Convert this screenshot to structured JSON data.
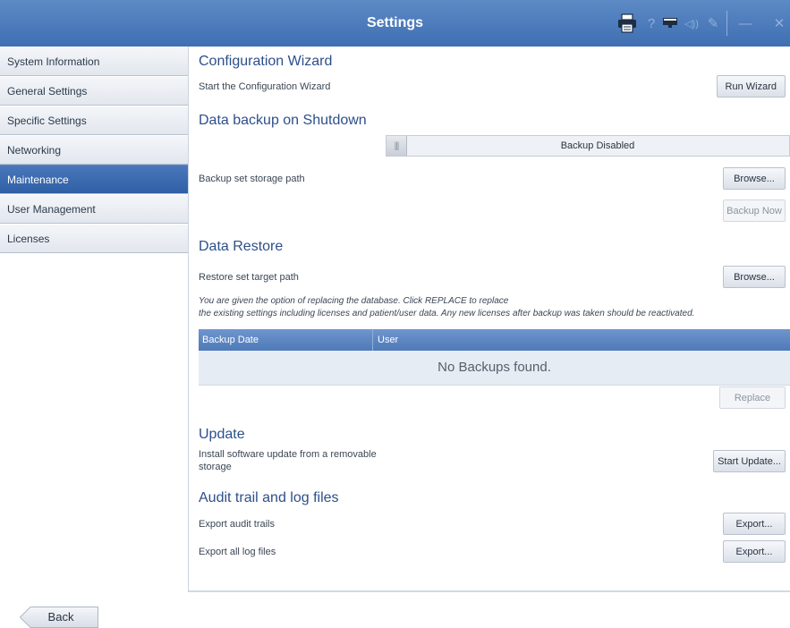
{
  "app": {
    "title": "Settings"
  },
  "toolbar": {
    "icons": [
      "printer-icon",
      "help-icon",
      "display-icon",
      "volume-icon",
      "tools-icon",
      "minimize-icon",
      "close-icon"
    ],
    "help_glyph": "?",
    "volume_glyph": "◁))",
    "tools_glyph": "✎",
    "minimize_glyph": "—",
    "close_glyph": "✕"
  },
  "sidebar": {
    "items": [
      {
        "label": "System Information"
      },
      {
        "label": "General Settings"
      },
      {
        "label": "Specific Settings"
      },
      {
        "label": "Networking"
      },
      {
        "label": "Maintenance",
        "active": true
      },
      {
        "label": "User Management"
      },
      {
        "label": "Licenses"
      }
    ]
  },
  "config_wizard": {
    "title": "Configuration Wizard",
    "description": "Start the Configuration Wizard",
    "button": "Run Wizard"
  },
  "backup": {
    "title": "Data backup on Shutdown",
    "toggle_label": "Backup Disabled",
    "storage_path_label": "Backup set storage path",
    "browse_button": "Browse...",
    "backup_now_button": "Backup Now"
  },
  "restore": {
    "title": "Data Restore",
    "target_path_label": "Restore set target path",
    "browse_button": "Browse...",
    "note_line1": "You are given the option of replacing the database. Click REPLACE to replace",
    "note_line2": "the existing settings including licenses and patient/user data. Any new licenses after backup was taken should be reactivated.",
    "table": {
      "columns": [
        "Backup Date",
        "User"
      ],
      "empty_message": "No Backups found."
    },
    "replace_button": "Replace"
  },
  "update": {
    "title": "Update",
    "description_line1": "Install software update from a removable",
    "description_line2": "storage",
    "button": "Start Update..."
  },
  "audit": {
    "title": "Audit trail and log files",
    "audit_label": "Export audit trails",
    "audit_button": "Export...",
    "log_label": "Export all log files",
    "log_button": "Export..."
  },
  "footer": {
    "back_button": "Back"
  },
  "colors": {
    "titlebar": "#4a78b8",
    "active_item": "#3a68ad",
    "section_title": "#2d4f8a"
  }
}
